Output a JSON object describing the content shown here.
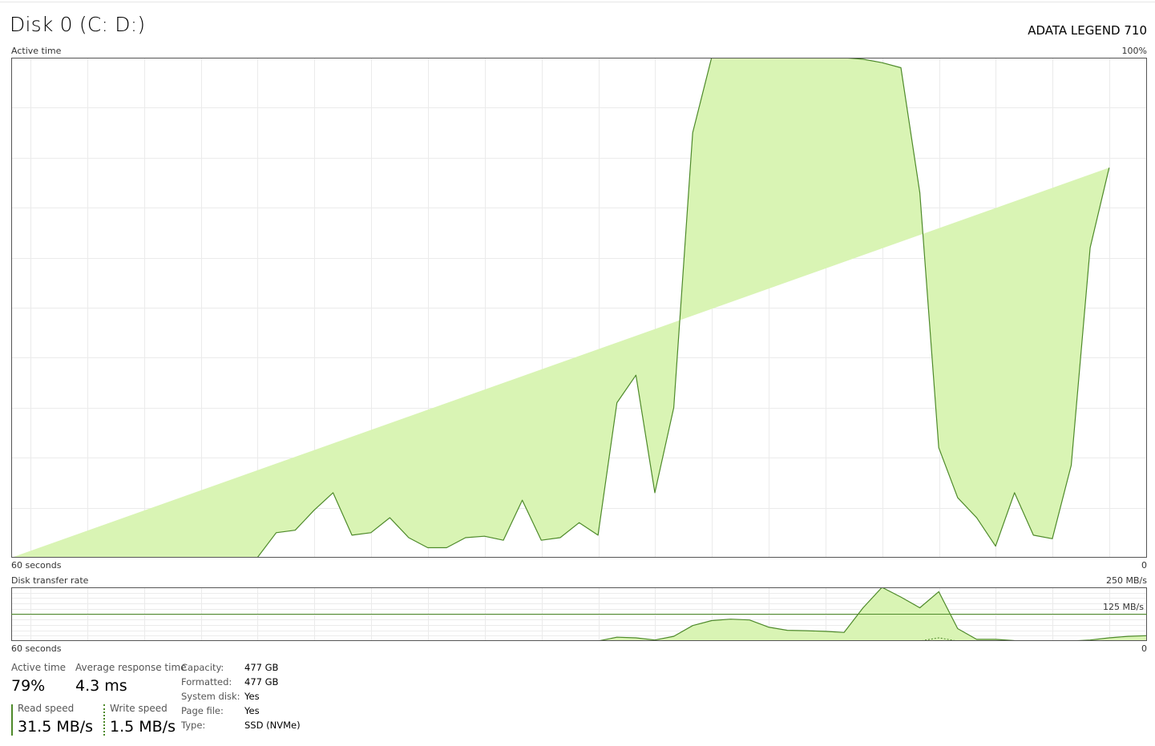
{
  "header": {
    "title": "Disk 0 (C: D:)",
    "model": "ADATA LEGEND 710"
  },
  "active_graph": {
    "label": "Active time",
    "max_label": "100%",
    "time_label": "60 seconds",
    "min_label": "0",
    "fill_color": "#d9f4b4",
    "line_color": "#4e8a2a"
  },
  "transfer_graph": {
    "label": "Disk transfer rate",
    "max_label": "250 MB/s",
    "mid_label": "125 MB/s",
    "time_label": "60 seconds",
    "min_label": "0"
  },
  "stats": {
    "active_time_label": "Active time",
    "active_time_value": "79%",
    "avg_response_label": "Average response time",
    "avg_response_value": "4.3 ms",
    "read_label": "Read speed",
    "read_value": "31.5 MB/s",
    "write_label": "Write speed",
    "write_value": "1.5 MB/s"
  },
  "properties": [
    {
      "label": "Capacity:",
      "value": "477 GB"
    },
    {
      "label": "Formatted:",
      "value": "477 GB"
    },
    {
      "label": "System disk:",
      "value": "Yes"
    },
    {
      "label": "Page file:",
      "value": "Yes"
    },
    {
      "label": "Type:",
      "value": "SSD (NVMe)"
    }
  ],
  "chart_data": [
    {
      "type": "area",
      "title": "Active time",
      "xlabel": "60 seconds",
      "ylabel": "",
      "xlim": [
        60,
        0
      ],
      "ylim": [
        0,
        100
      ],
      "x": [
        60,
        59,
        58,
        57,
        56,
        55,
        54,
        53,
        52,
        51,
        50,
        49,
        48,
        47,
        46,
        45,
        44,
        43,
        42,
        41,
        40,
        39,
        38,
        37,
        36,
        35,
        34,
        33,
        32,
        31,
        30,
        29,
        28,
        27,
        26,
        25,
        24,
        23,
        22,
        21,
        20,
        19,
        18,
        17,
        16,
        15,
        14,
        13,
        12,
        11,
        10,
        9,
        8,
        7,
        6,
        5,
        4,
        3,
        2,
        1,
        0
      ],
      "series": [
        {
          "values": [
            0,
            0,
            0,
            0,
            0,
            0,
            0,
            0,
            0,
            0,
            0,
            0,
            0,
            0,
            5,
            5.5,
            9.5,
            13,
            4.5,
            5,
            8,
            4,
            2,
            2,
            4,
            4.3,
            3.5,
            11.5,
            3.5,
            4,
            7,
            4.5,
            31,
            36.5,
            13,
            30,
            85,
            100,
            100,
            100,
            100,
            100,
            100,
            100,
            100,
            99.7,
            99,
            98,
            73,
            22,
            12,
            8,
            2.3,
            13,
            4.5,
            3.8,
            18.5,
            62,
            78
          ]
        }
      ]
    },
    {
      "type": "area",
      "title": "Disk transfer rate",
      "xlabel": "60 seconds",
      "ylabel": "",
      "xlim": [
        60,
        0
      ],
      "ylim": [
        0,
        250
      ],
      "x": [
        29,
        28,
        27,
        26,
        25,
        24,
        23,
        22,
        21,
        20,
        19,
        18,
        17,
        16,
        15,
        14,
        13,
        12,
        11,
        10,
        9,
        8,
        7,
        6,
        5,
        4,
        3,
        2,
        1,
        0
      ],
      "series": [
        {
          "name": "Read speed",
          "values": [
            0,
            18,
            15,
            5,
            22,
            72,
            95,
            102,
            98,
            65,
            50,
            48,
            45,
            40,
            155,
            250,
            205,
            155,
            230,
            58,
            8,
            8,
            2,
            0,
            0,
            0,
            5,
            15,
            22,
            25
          ]
        },
        {
          "name": "Write speed",
          "values": [
            0,
            0,
            0,
            0,
            0,
            0,
            0,
            0,
            0,
            0,
            0,
            0,
            0,
            0,
            0,
            0,
            0,
            0,
            15,
            0,
            0,
            0,
            0,
            0,
            0,
            0,
            0,
            0,
            0,
            2
          ]
        }
      ]
    }
  ]
}
